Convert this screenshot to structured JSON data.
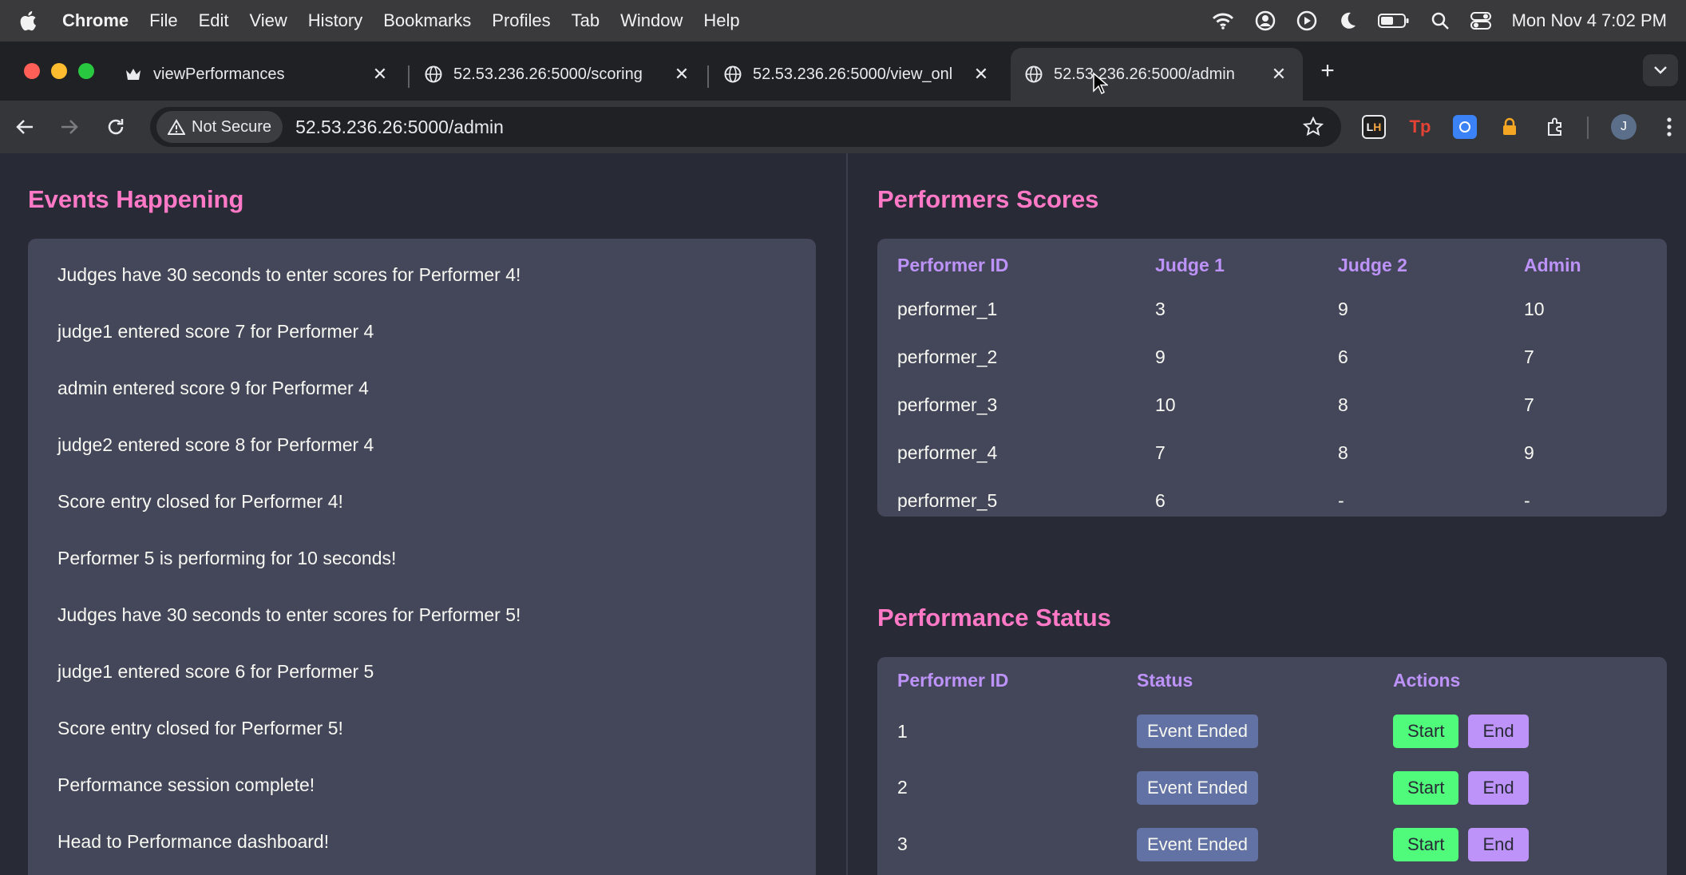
{
  "menubar": {
    "app_name": "Chrome",
    "items": [
      "File",
      "Edit",
      "View",
      "History",
      "Bookmarks",
      "Profiles",
      "Tab",
      "Window",
      "Help"
    ],
    "clock": "Mon Nov 4  7:02 PM"
  },
  "tabs": [
    {
      "title": "viewPerformances",
      "icon": "crown-favicon"
    },
    {
      "title": "52.53.236.26:5000/scoring",
      "icon": "globe-icon"
    },
    {
      "title": "52.53.236.26:5000/view_onl",
      "icon": "globe-icon"
    },
    {
      "title": "52.53.236.26:5000/admin",
      "icon": "globe-icon",
      "active": true
    }
  ],
  "toolbar": {
    "security_label": "Not Secure",
    "url": "52.53.236.26:5000/admin",
    "avatar_letter": "J"
  },
  "events_section": {
    "title": "Events Happening",
    "items": [
      "Judges have 30 seconds to enter scores for Performer 4!",
      "judge1 entered score 7 for Performer 4",
      "admin entered score 9 for Performer 4",
      "judge2 entered score 8 for Performer 4",
      "Score entry closed for Performer 4!",
      "Performer 5 is performing for 10 seconds!",
      "Judges have 30 seconds to enter scores for Performer 5!",
      "judge1 entered score 6 for Performer 5",
      "Score entry closed for Performer 5!",
      "Performance session complete!",
      "Head to Performance dashboard!"
    ]
  },
  "scores_section": {
    "title": "Performers Scores",
    "columns": [
      "Performer ID",
      "Judge 1",
      "Judge 2",
      "Admin"
    ],
    "rows": [
      [
        "performer_1",
        "3",
        "9",
        "10"
      ],
      [
        "performer_2",
        "9",
        "6",
        "7"
      ],
      [
        "performer_3",
        "10",
        "8",
        "7"
      ],
      [
        "performer_4",
        "7",
        "8",
        "9"
      ],
      [
        "performer_5",
        "6",
        "-",
        "-"
      ]
    ]
  },
  "status_section": {
    "title": "Performance Status",
    "columns": [
      "Performer ID",
      "Status",
      "Actions"
    ],
    "start_label": "Start",
    "end_label": "End",
    "rows": [
      {
        "id": "1",
        "status": "Event Ended"
      },
      {
        "id": "2",
        "status": "Event Ended"
      },
      {
        "id": "3",
        "status": "Event Ended"
      }
    ]
  },
  "colors": {
    "heading": "#ff79c6",
    "table_header": "#bd93f9",
    "start_button": "#50fa7b",
    "end_button": "#bd93f9",
    "badge": "#6272a4",
    "panel": "#44475a",
    "background": "#282a36"
  }
}
